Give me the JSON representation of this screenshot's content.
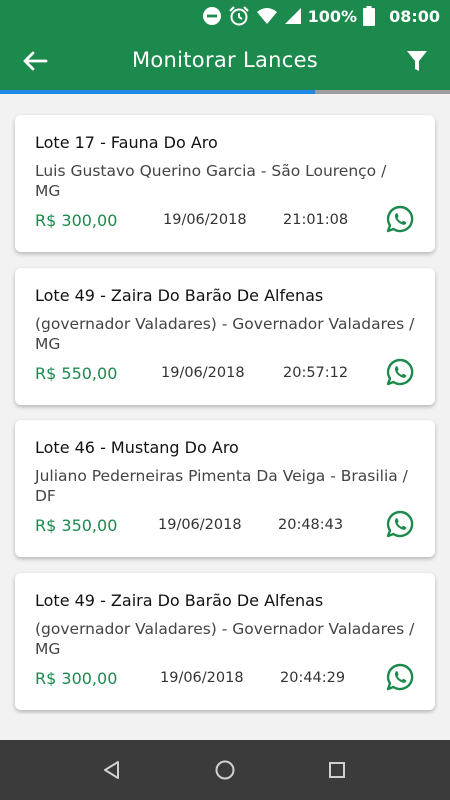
{
  "status_bar": {
    "battery_percent": "100%",
    "time": "08:00",
    "icons": [
      "do-not-disturb-icon",
      "alarm-icon",
      "wifi-icon",
      "signal-icon",
      "battery-icon"
    ]
  },
  "app_bar": {
    "title": "Monitorar Lances",
    "back_icon": "arrow-left-icon",
    "filter_icon": "filter-icon",
    "background": "#1b8a4c"
  },
  "loading_progress": 0.7,
  "colors": {
    "accent_green": "#1b8a4c",
    "progress_blue": "#1e88e5",
    "whatsapp_green": "#1b8a4c"
  },
  "bids": [
    {
      "title": "Lote 17 - Fauna Do Aro",
      "subtitle": "Luis Gustavo Querino Garcia - São Lourenço / MG",
      "price": "R$ 300,00",
      "date": "19/06/2018",
      "time": "21:01:08"
    },
    {
      "title": "Lote 49 - Zaira Do Barão De Alfenas",
      "subtitle": "(governador Valadares) - Governador Valadares / MG",
      "price": "R$ 550,00",
      "date": "19/06/2018",
      "time": "20:57:12"
    },
    {
      "title": "Lote 46 - Mustang Do Aro",
      "subtitle": "Juliano Pederneiras Pimenta Da Veiga - Brasilia / DF",
      "price": "R$ 350,00",
      "date": "19/06/2018",
      "time": "20:48:43"
    },
    {
      "title": "Lote 49 - Zaira Do Barão De Alfenas",
      "subtitle": "(governador Valadares) - Governador Valadares / MG",
      "price": "R$ 300,00",
      "date": "19/06/2018",
      "time": "20:44:29"
    }
  ],
  "nav_bar": {
    "icons": [
      "back-triangle-icon",
      "home-circle-icon",
      "recents-square-icon"
    ]
  }
}
